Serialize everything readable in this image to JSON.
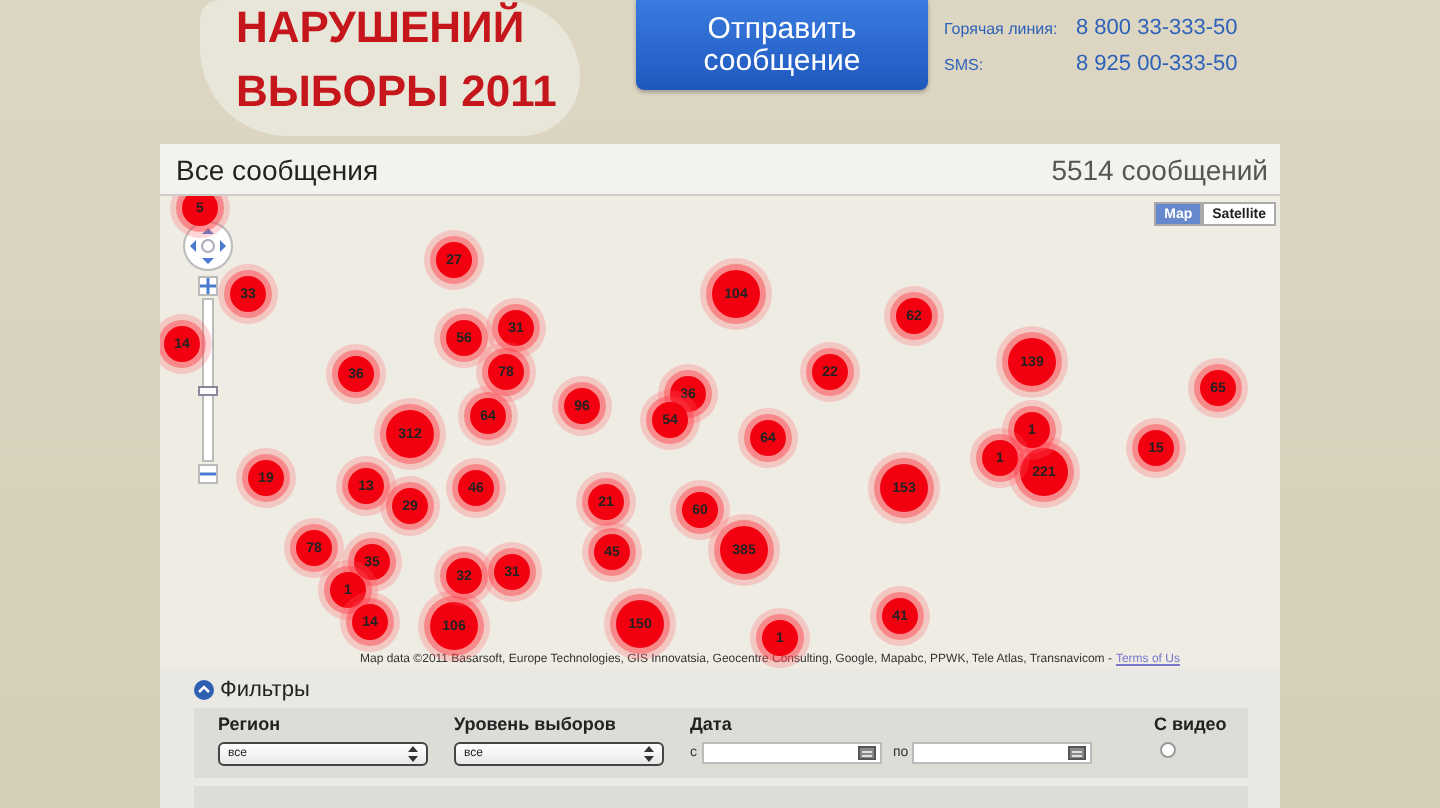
{
  "header": {
    "logo_lines": [
      "НАРУШЕНИЙ",
      "ВЫБОРЫ 2011"
    ],
    "send_button": "Отправить сообщение",
    "contacts": [
      {
        "label": "Горячая линия:",
        "number": "8 800 33-333-50"
      },
      {
        "label": "SMS:",
        "number": "8 925 00-333-50"
      }
    ]
  },
  "messages": {
    "title": "Все сообщения",
    "count": "5514 сообщений"
  },
  "map": {
    "type_buttons": [
      {
        "label": "Map",
        "selected": true
      },
      {
        "label": "Satellite",
        "selected": false
      }
    ],
    "zoom": {
      "level": 0.43
    },
    "markers": [
      {
        "count": "5"
      },
      {
        "count": "27"
      },
      {
        "count": "33"
      },
      {
        "count": "104"
      },
      {
        "count": "62"
      },
      {
        "count": "14"
      },
      {
        "count": "56"
      },
      {
        "count": "31"
      },
      {
        "count": "36"
      },
      {
        "count": "78"
      },
      {
        "count": "22"
      },
      {
        "count": "139"
      },
      {
        "count": "36"
      },
      {
        "count": "65"
      },
      {
        "count": "64"
      },
      {
        "count": "96"
      },
      {
        "count": "54"
      },
      {
        "count": "312"
      },
      {
        "count": "64"
      },
      {
        "count": "1"
      },
      {
        "count": "15"
      },
      {
        "count": "1"
      },
      {
        "count": "221"
      },
      {
        "count": "19"
      },
      {
        "count": "13"
      },
      {
        "count": "46"
      },
      {
        "count": "153"
      },
      {
        "count": "29"
      },
      {
        "count": "21"
      },
      {
        "count": "60"
      },
      {
        "count": "78"
      },
      {
        "count": "45"
      },
      {
        "count": "385"
      },
      {
        "count": "35"
      },
      {
        "count": "32"
      },
      {
        "count": "31"
      },
      {
        "count": "1"
      },
      {
        "count": "14"
      },
      {
        "count": "106"
      },
      {
        "count": "150"
      },
      {
        "count": "41"
      },
      {
        "count": "1"
      }
    ],
    "attribution": "Map data ©2011 Basarsoft, Europe Technologies, GIS Innovatsia, Geocentre Consulting, Google, Mapabc, PPWK, Tele Atlas, Transnavicom -",
    "terms_link": "Terms of Us"
  },
  "filters": {
    "title": "Фильтры",
    "expanded": true,
    "fields": [
      {
        "kind": "select",
        "label": "Регион",
        "value": "все"
      },
      {
        "kind": "select",
        "label": "Уровень выборов",
        "value": "все"
      },
      {
        "kind": "date_range",
        "label": "Дата",
        "from_label": "с",
        "to_label": "по"
      },
      {
        "kind": "checkbox",
        "label": "С видео",
        "checked": false
      }
    ]
  }
}
